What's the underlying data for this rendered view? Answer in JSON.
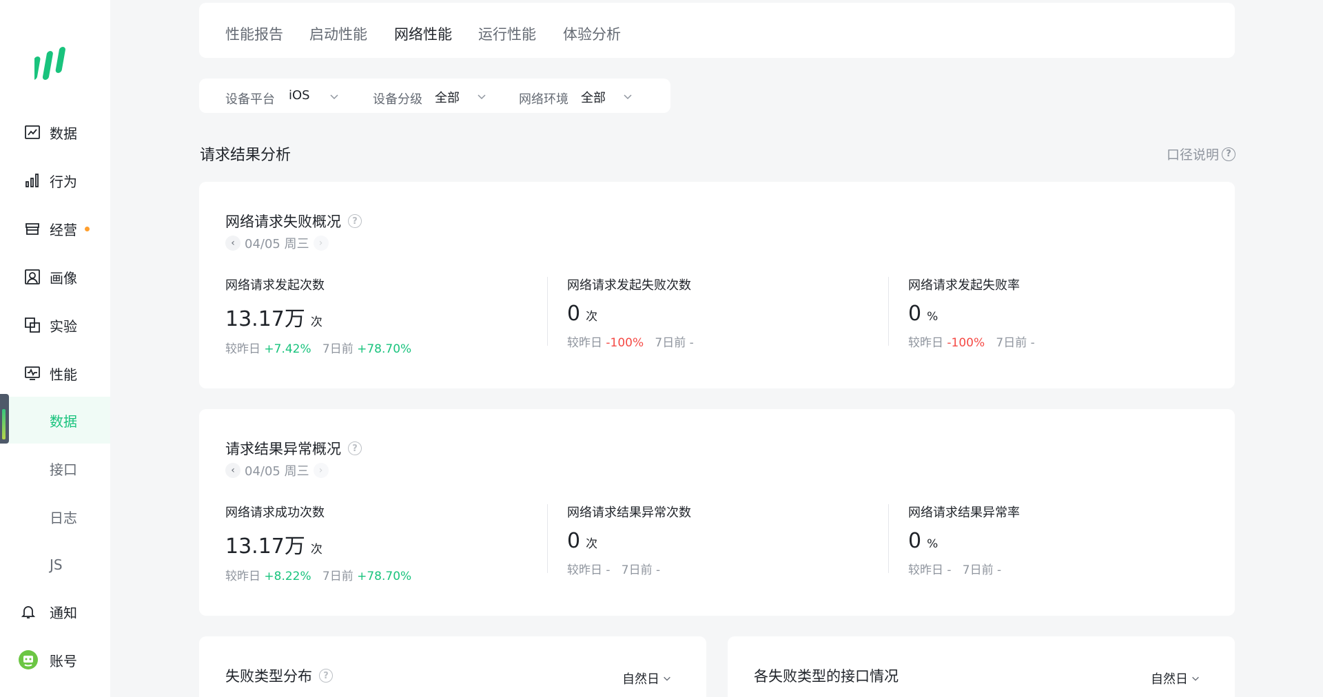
{
  "sidebar": {
    "items": [
      {
        "label": "数据",
        "icon": "chart-line-icon"
      },
      {
        "label": "行为",
        "icon": "bar-chart-icon"
      },
      {
        "label": "经营",
        "icon": "store-icon"
      },
      {
        "label": "画像",
        "icon": "portrait-icon"
      },
      {
        "label": "实验",
        "icon": "experiment-icon"
      },
      {
        "label": "性能",
        "icon": "monitor-icon"
      }
    ],
    "sub_items": [
      {
        "label": "数据",
        "active": true
      },
      {
        "label": "接口",
        "active": false
      },
      {
        "label": "日志",
        "active": false
      },
      {
        "label": "JS",
        "active": false
      }
    ],
    "bottom_items": [
      {
        "label": "通知",
        "icon": "bell-icon"
      },
      {
        "label": "账号",
        "icon": "account-avatar-icon"
      }
    ],
    "accent_color": "#19c37d",
    "badge_color": "#ff9f2d"
  },
  "tabs": [
    {
      "label": "性能报告",
      "active": false
    },
    {
      "label": "启动性能",
      "active": false
    },
    {
      "label": "网络性能",
      "active": true
    },
    {
      "label": "运行性能",
      "active": false
    },
    {
      "label": "体验分析",
      "active": false
    }
  ],
  "filters": [
    {
      "label": "设备平台",
      "value": "iOS"
    },
    {
      "label": "设备分级",
      "value": "全部"
    },
    {
      "label": "网络环境",
      "value": "全部"
    }
  ],
  "section": {
    "title": "请求结果分析",
    "caliber": "口径说明"
  },
  "card1": {
    "title": "网络请求失败概况",
    "date": "04/05 周三",
    "metrics": [
      {
        "label": "网络请求发起次数",
        "value": "13.17万",
        "unit": "次",
        "day_label": "较昨日",
        "day_value": "+7.42%",
        "week_label": "7日前",
        "week_value": "+78.70%"
      },
      {
        "label": "网络请求发起失败次数",
        "value": "0",
        "unit": "次",
        "day_label": "较昨日",
        "day_value": "-100%",
        "week_label": "7日前",
        "week_value": "-"
      },
      {
        "label": "网络请求发起失败率",
        "value": "0",
        "unit": "%",
        "day_label": "较昨日",
        "day_value": "-100%",
        "week_label": "7日前",
        "week_value": "-"
      }
    ]
  },
  "card2": {
    "title": "请求结果异常概况",
    "date": "04/05 周三",
    "metrics": [
      {
        "label": "网络请求成功次数",
        "value": "13.17万",
        "unit": "次",
        "day_label": "较昨日",
        "day_value": "+8.22%",
        "week_label": "7日前",
        "week_value": "+78.70%"
      },
      {
        "label": "网络请求结果异常次数",
        "value": "0",
        "unit": "次",
        "day_label": "较昨日",
        "day_value": "-",
        "week_label": "7日前",
        "week_value": "-"
      },
      {
        "label": "网络请求结果异常率",
        "value": "0",
        "unit": "%",
        "day_label": "较昨日",
        "day_value": "-",
        "week_label": "7日前",
        "week_value": "-"
      }
    ]
  },
  "card3": {
    "title": "失败类型分布",
    "period": "自然日"
  },
  "card4": {
    "title": "各失败类型的接口情况",
    "period": "自然日"
  }
}
